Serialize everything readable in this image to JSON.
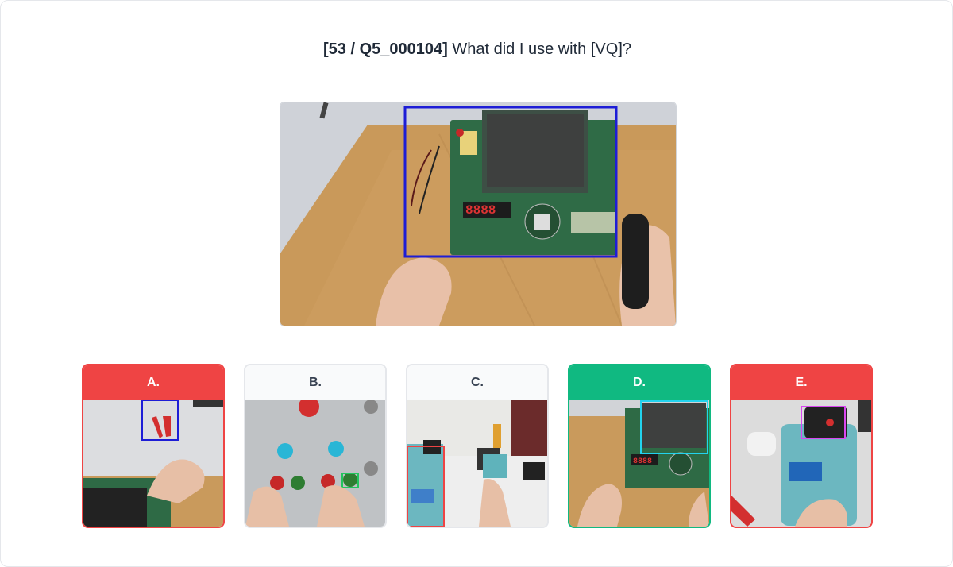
{
  "question": {
    "id_text": "[53 / Q5_000104]",
    "text": "What did I use with [VQ]?"
  },
  "colors": {
    "correct": "#10b981",
    "wrong": "#ef4444",
    "neutral_border": "#e5e7eb",
    "query_box": "#1d1dd6"
  },
  "options": [
    {
      "label": "A.",
      "status": "wrong",
      "scene": "pliers on desk, hand near PCB board",
      "box_color": "#1d1dd6"
    },
    {
      "label": "B.",
      "status": "neutral",
      "scene": "fingers pressing colored push buttons",
      "box_color": "#22c55e"
    },
    {
      "label": "C.",
      "status": "neutral",
      "scene": "soldering station on table",
      "box_color": "#ef4444"
    },
    {
      "label": "D.",
      "status": "correct",
      "scene": "development board with LCD screen",
      "box_color": "#22d3ee"
    },
    {
      "label": "E.",
      "status": "wrong",
      "scene": "hand adjusting soldering station",
      "box_color": "#d946ef"
    }
  ]
}
